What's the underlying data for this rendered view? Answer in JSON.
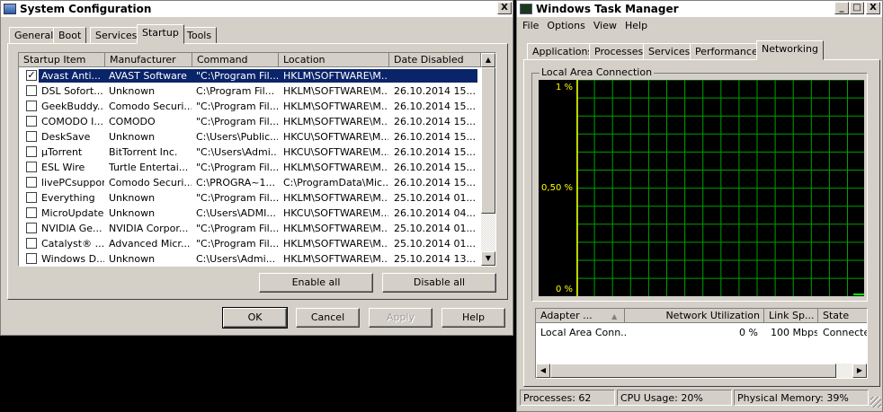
{
  "syscfg": {
    "title": "System Configuration",
    "close_label": "X",
    "tabs": [
      "General",
      "Boot",
      "Services",
      "Startup",
      "Tools"
    ],
    "active_tab": "Startup",
    "columns": [
      "Startup Item",
      "Manufacturer",
      "Command",
      "Location",
      "Date Disabled"
    ],
    "rows": [
      {
        "checked": "✓",
        "item": "Avast Anti...",
        "manufacturer": "AVAST Software",
        "command": "\"C:\\Program Fil...",
        "location": "HKLM\\SOFTWARE\\M...",
        "date": ""
      },
      {
        "checked": "",
        "item": "DSL Sofort...",
        "manufacturer": "Unknown",
        "command": "C:\\Program Fil...",
        "location": "HKLM\\SOFTWARE\\M...",
        "date": "26.10.2014 15..."
      },
      {
        "checked": "",
        "item": "GeekBuddy...",
        "manufacturer": "Comodo Securi...",
        "command": "\"C:\\Program Fil...",
        "location": "HKLM\\SOFTWARE\\M...",
        "date": "26.10.2014 15..."
      },
      {
        "checked": "",
        "item": "COMODO I...",
        "manufacturer": "COMODO",
        "command": "\"C:\\Program Fil...",
        "location": "HKLM\\SOFTWARE\\M...",
        "date": "26.10.2014 15..."
      },
      {
        "checked": "",
        "item": "DeskSave",
        "manufacturer": "Unknown",
        "command": "C:\\Users\\Public...",
        "location": "HKCU\\SOFTWARE\\M...",
        "date": "26.10.2014 15..."
      },
      {
        "checked": "",
        "item": "µTorrent",
        "manufacturer": "BitTorrent Inc.",
        "command": "\"C:\\Users\\Admi...",
        "location": "HKCU\\SOFTWARE\\M...",
        "date": "26.10.2014 15..."
      },
      {
        "checked": "",
        "item": "ESL Wire",
        "manufacturer": "Turtle Entertai...",
        "command": "\"C:\\Program Fil...",
        "location": "HKLM\\SOFTWARE\\M...",
        "date": "26.10.2014 15..."
      },
      {
        "checked": "",
        "item": "livePCsupport",
        "manufacturer": "Comodo Securi...",
        "command": "C:\\PROGRA~1...",
        "location": "C:\\ProgramData\\Mic...",
        "date": "26.10.2014 15..."
      },
      {
        "checked": "",
        "item": "Everything",
        "manufacturer": "Unknown",
        "command": "\"C:\\Program Fil...",
        "location": "HKLM\\SOFTWARE\\M...",
        "date": "25.10.2014 01..."
      },
      {
        "checked": "",
        "item": "MicroUpdate",
        "manufacturer": "Unknown",
        "command": "C:\\Users\\ADMI...",
        "location": "HKCU\\SOFTWARE\\M...",
        "date": "26.10.2014 04..."
      },
      {
        "checked": "",
        "item": "NVIDIA Ge...",
        "manufacturer": "NVIDIA Corpor...",
        "command": "\"C:\\Program Fil...",
        "location": "HKLM\\SOFTWARE\\M...",
        "date": "25.10.2014 01..."
      },
      {
        "checked": "",
        "item": "Catalyst® ...",
        "manufacturer": "Advanced Micr...",
        "command": "\"C:\\Program Fil...",
        "location": "HKLM\\SOFTWARE\\M...",
        "date": "25.10.2014 01..."
      },
      {
        "checked": "",
        "item": "Windows D...",
        "manufacturer": "Unknown",
        "command": "C:\\Users\\Admi...",
        "location": "HKLM\\SOFTWARE\\M...",
        "date": "25.10.2014 13..."
      }
    ],
    "enable_all": "Enable all",
    "disable_all": "Disable all",
    "ok": "OK",
    "cancel": "Cancel",
    "apply": "Apply",
    "help": "Help"
  },
  "taskmgr": {
    "title": "Windows Task Manager",
    "min_label": "_",
    "max_label": "□",
    "close_label": "X",
    "menu": [
      "File",
      "Options",
      "View",
      "Help"
    ],
    "tabs": [
      "Applications",
      "Processes",
      "Services",
      "Performance",
      "Networking"
    ],
    "active_tab": "Networking",
    "group_label": "Local Area Connection",
    "y_labels": [
      "1 %",
      "0,50 %",
      "0 %"
    ],
    "grid_color": "#00a000",
    "line_color": "#00ff00",
    "table_headers": [
      "Adapter ...",
      "Network Utilization",
      "Link Sp...",
      "State"
    ],
    "table_row": {
      "adapter": "Local Area Conn...",
      "utilization": "0 %",
      "speed": "100 Mbps",
      "state": "Connected"
    },
    "status": {
      "processes": "Processes: 62",
      "cpu": "CPU Usage: 20%",
      "memory": "Physical Memory: 39%"
    }
  }
}
